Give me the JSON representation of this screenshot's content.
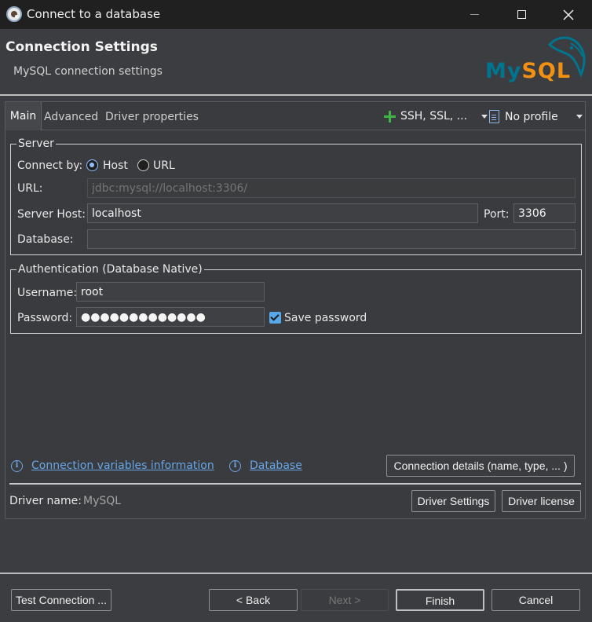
{
  "window": {
    "title": "Connect to a database"
  },
  "header": {
    "title": "Connection Settings",
    "subtitle": "MySQL connection settings",
    "logo_parts": [
      "My",
      "SQL"
    ]
  },
  "tabs": {
    "main": "Main",
    "advanced": "Advanced",
    "driver_properties": "Driver properties"
  },
  "toolbar": {
    "ssh_label": "SSH, SSL, ...",
    "profile_label": "No profile"
  },
  "server": {
    "title": "Server",
    "connect_by_label": "Connect by:",
    "host_option": "Host",
    "url_option": "URL",
    "url_label": "URL:",
    "url_value": "jdbc:mysql://localhost:3306/",
    "host_label": "Server Host:",
    "host_value": "localhost",
    "port_label": "Port:",
    "port_value": "3306",
    "database_label": "Database:",
    "database_value": ""
  },
  "auth": {
    "title": "Authentication (Database Native)",
    "username_label": "Username:",
    "username_value": "root",
    "password_label": "Password:",
    "password_value": "●●●●●●●●●●●●●",
    "save_password_label": "Save password",
    "save_password_checked": true
  },
  "links": {
    "connection_vars": "Connection variables information",
    "database": "Database"
  },
  "buttons": {
    "connection_details": "Connection details (name, type, ... )",
    "driver_settings": "Driver Settings",
    "driver_license": "Driver license",
    "test_connection": "Test Connection ...",
    "back": "< Back",
    "next": "Next >",
    "finish": "Finish",
    "cancel": "Cancel"
  },
  "driver": {
    "name_label": "Driver name:",
    "name_value": "MySQL"
  },
  "colors": {
    "link": "#67a6e8",
    "accent_green": "#41b545",
    "mysql_blue": "#00758f",
    "mysql_orange": "#f29111"
  }
}
